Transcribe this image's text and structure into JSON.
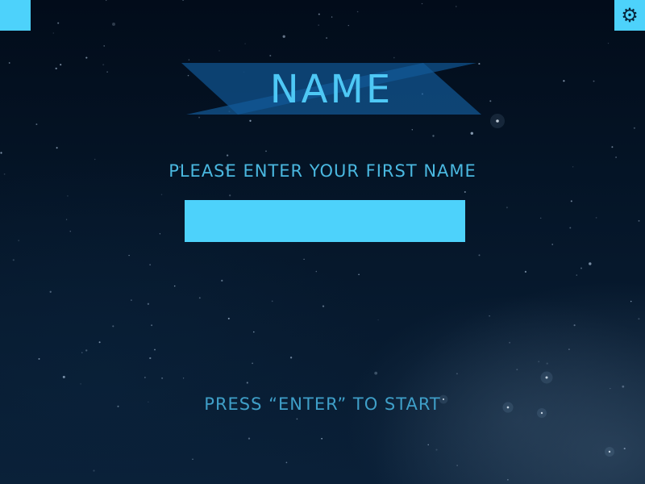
{
  "title": "NAME",
  "prompt": "PLEASE ENTER YOUR FIRST NAME",
  "name_input": {
    "value": "",
    "placeholder": ""
  },
  "start_hint": "PRESS “ENTER” TO START",
  "corner_left": {
    "icon": "square-button"
  },
  "corner_right": {
    "icon": "gear-icon",
    "glyph": "⚙"
  },
  "colors": {
    "accent": "#4dd2fb",
    "title_text": "#4ec8f5",
    "prompt_text": "#4ab8e0",
    "hint_text": "#3f9fc8",
    "banner_dark": "#0a3560",
    "banner_mid": "#0e4a80",
    "banner_light": "#125a98",
    "background": "#020f1f"
  }
}
